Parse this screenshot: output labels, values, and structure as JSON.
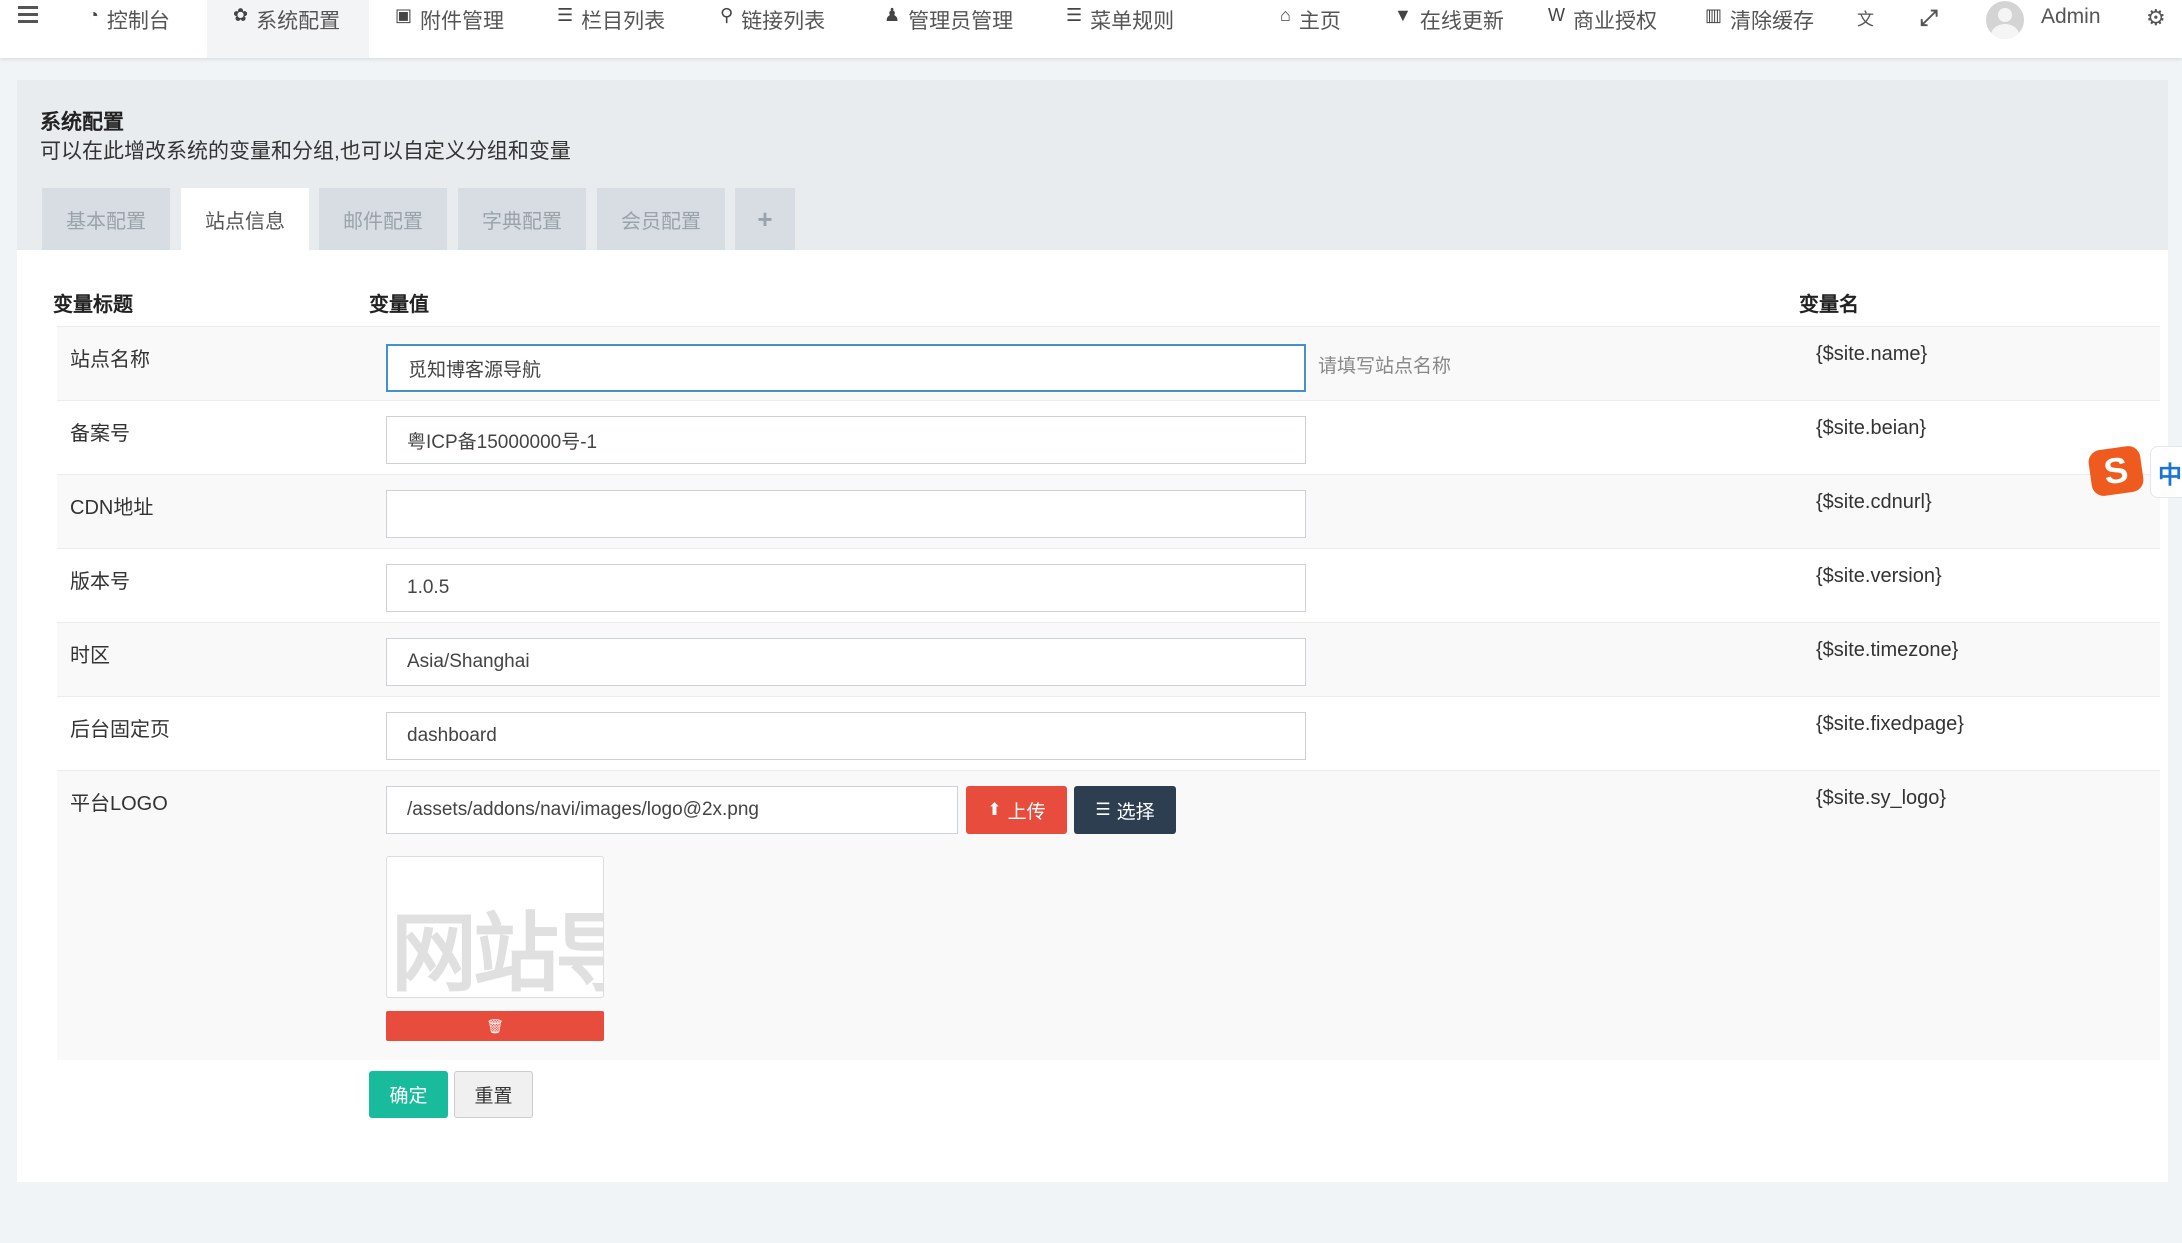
{
  "nav": {
    "items": [
      {
        "icon": "dashboard-icon",
        "glyph": "◔",
        "label": "控制台"
      },
      {
        "icon": "gear-icon",
        "glyph": "✿",
        "label": "系统配置"
      },
      {
        "icon": "image-icon",
        "glyph": "▣",
        "label": "附件管理"
      },
      {
        "icon": "list-icon",
        "glyph": "☰",
        "label": "栏目列表"
      },
      {
        "icon": "link-icon",
        "glyph": "⚲",
        "label": "链接列表"
      },
      {
        "icon": "user-icon",
        "glyph": "♟",
        "label": "管理员管理"
      },
      {
        "icon": "menu-icon",
        "glyph": "☰",
        "label": "菜单规则"
      }
    ],
    "right": [
      {
        "icon": "home-icon",
        "glyph": "⌂",
        "label": "主页"
      },
      {
        "icon": "update-icon",
        "glyph": "▼",
        "label": "在线更新"
      },
      {
        "icon": "license-icon",
        "glyph": "W",
        "label": "商业授权"
      },
      {
        "icon": "trash-icon",
        "glyph": "▥",
        "label": "清除缓存"
      }
    ],
    "lang_glyph": "文",
    "fullscreen_glyph": "⤢",
    "user": "Admin",
    "settings_glyph": "⚙"
  },
  "panel": {
    "title": "系统配置",
    "subtitle": "可以在此增改系统的变量和分组,也可以自定义分组和变量",
    "tabs": [
      "基本配置",
      "站点信息",
      "邮件配置",
      "字典配置",
      "会员配置"
    ],
    "add_tab": "+"
  },
  "table": {
    "headers": {
      "title": "变量标题",
      "value": "变量值",
      "name": "变量名"
    },
    "rows": [
      {
        "label": "站点名称",
        "value": "觅知博客源导航",
        "placeholder": "",
        "hint": "请填写站点名称",
        "var": "{$site.name}"
      },
      {
        "label": "备案号",
        "value": "粤ICP备15000000号-1",
        "placeholder": "",
        "var": "{$site.beian}"
      },
      {
        "label": "CDN地址",
        "value": "",
        "placeholder": "",
        "var": "{$site.cdnurl}"
      },
      {
        "label": "版本号",
        "value": "1.0.5",
        "placeholder": "",
        "var": "{$site.version}"
      },
      {
        "label": "时区",
        "value": "Asia/Shanghai",
        "placeholder": "",
        "var": "{$site.timezone}"
      },
      {
        "label": "后台固定页",
        "value": "dashboard",
        "placeholder": "",
        "var": "{$site.fixedpage}"
      },
      {
        "label": "平台LOGO",
        "value": "/assets/addons/navi/images/logo@2x.png",
        "placeholder": "",
        "var": "{$site.sy_logo}"
      }
    ],
    "upload_label": "上传",
    "choose_label": "选择",
    "logo_preview_text": "网站导",
    "delete_glyph": "🗑"
  },
  "form": {
    "submit_label": "确定",
    "reset_label": "重置"
  },
  "ime": {
    "s": "S",
    "zh": "中"
  },
  "colors": {
    "primary": "#18bc9c",
    "danger": "#e74c3c",
    "dark": "#2c3e50",
    "focus": "#4a90c8"
  }
}
